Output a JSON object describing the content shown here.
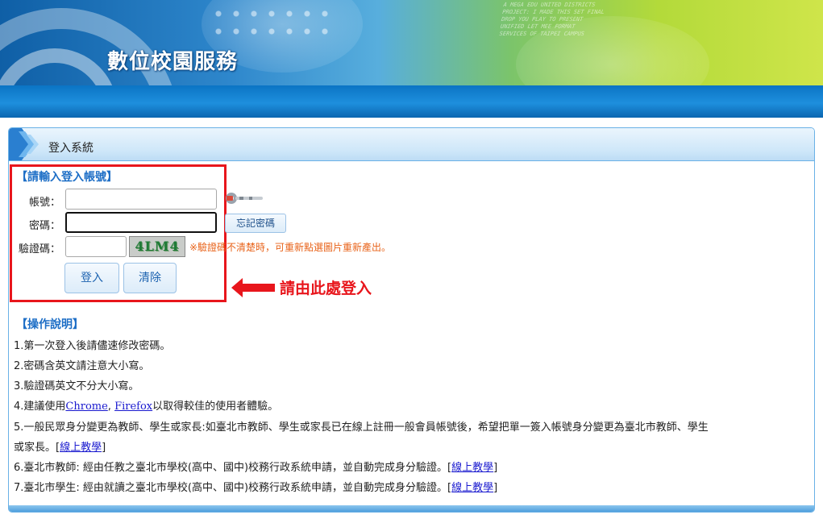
{
  "header": {
    "site_title": "數位校園服務",
    "deco_text": [
      "A MEGA EDU UNITED DISTRICTS",
      "PROJECT: I MADE THIS SET FINAL",
      "DROP YOU PLAY TO PRESENT",
      "UNIFIED LET MEE FORMAT",
      "SERVICES OF TAIPEI CAMPUS"
    ]
  },
  "panel": {
    "title": "登入系統"
  },
  "login": {
    "section_title": "【請輸入登入帳號】",
    "account_label": "帳號：",
    "account_value": "",
    "password_label": "密碼：",
    "password_value": "",
    "captcha_label": "驗證碼：",
    "captcha_value": "",
    "captcha_text": "4LM4",
    "captcha_note": "※驗證碼不清楚時，可重新點選圖片重新產出。",
    "forgot_button": "忘記密碼",
    "login_button": "登入",
    "clear_button": "清除"
  },
  "callout": {
    "text": "請由此處登入"
  },
  "instructions": {
    "title": "【操作說明】",
    "item1": "1.第一次登入後請儘速修改密碼。",
    "item2": "2.密碼含英文請注意大小寫。",
    "item3": "3.驗證碼英文不分大小寫。",
    "item4_prefix": "4.建議使用",
    "item4_link1": "Chrome",
    "item4_sep": ", ",
    "item4_link2": "Firefox",
    "item4_suffix": "以取得較佳的使用者體驗。",
    "item5_line1": "5.一般民眾身分變更為教師、學生或家長:如臺北市教師、學生或家長已在線上註冊一般會員帳號後，希望把單一簽入帳號身分變更為臺北市教師、學生",
    "item5_line2_prefix": "或家長。[",
    "item5_link": "線上教學",
    "item5_suffix": "]",
    "item6_prefix": "6.臺北市教師: 經由任教之臺北市學校(高中、國中)校務行政系統申請，並自動完成身分驗證。[",
    "item6_link": "線上教學",
    "item6_suffix": "]",
    "item7_prefix": "7.臺北市學生: 經由就讀之臺北市學校(高中、國中)校務行政系統申請，並自動完成身分驗證。[",
    "item7_link": "線上教學",
    "item7_suffix": "]"
  },
  "colors": {
    "accent_blue": "#1d6ec6",
    "callout_red": "#e8161c",
    "note_orange": "#e8631a",
    "link_blue": "#1a1acf"
  },
  "icons": [
    "chevron-logo-icon",
    "keychain-icon",
    "arrow-left-icon"
  ]
}
